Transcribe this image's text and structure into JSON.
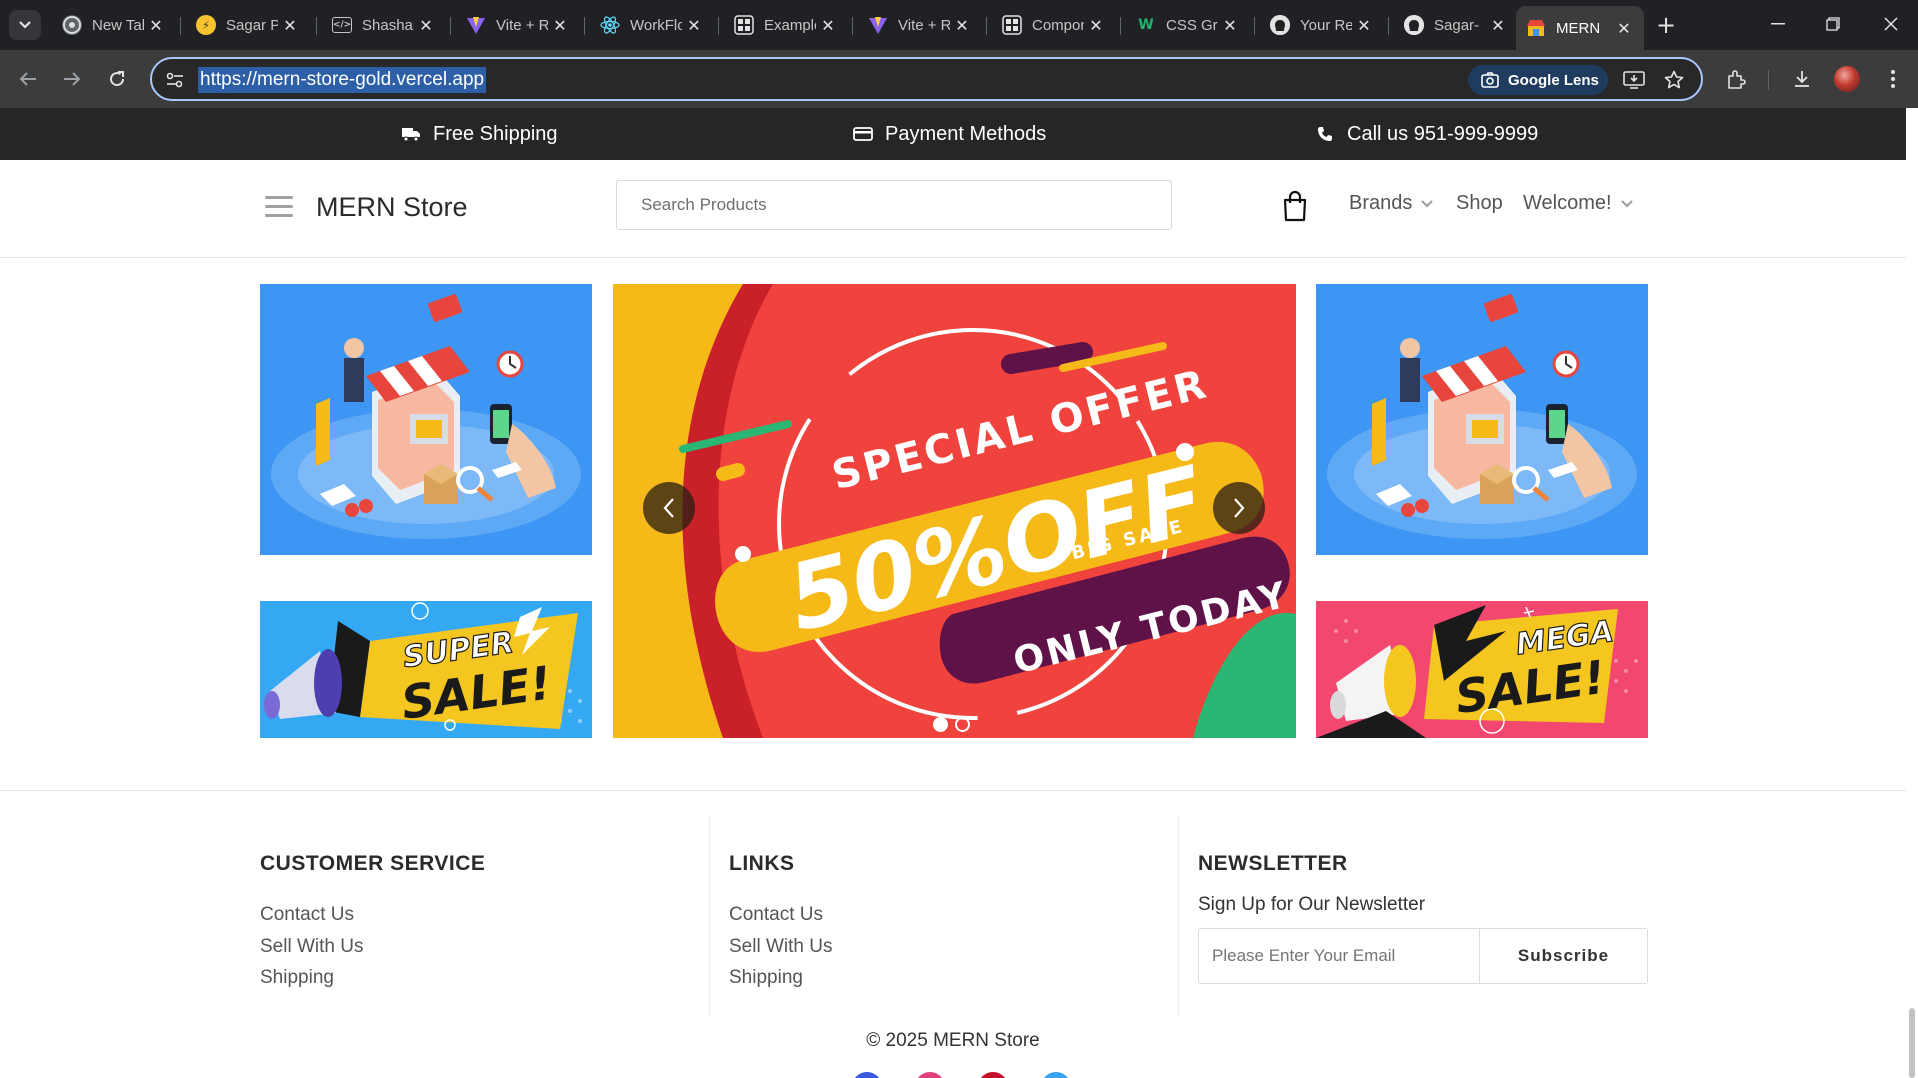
{
  "browser": {
    "tabs": [
      {
        "label": "New Tab",
        "icon": "chrome-icon"
      },
      {
        "label": "Sagar Portfolio",
        "icon": "lightning-icon"
      },
      {
        "label": "Shashank",
        "icon": "code-icon"
      },
      {
        "label": "Vite + React",
        "icon": "vite-icon"
      },
      {
        "label": "WorkFlow",
        "icon": "react-icon"
      },
      {
        "label": "Examples",
        "icon": "grid-icon"
      },
      {
        "label": "Vite + React",
        "icon": "vite-icon"
      },
      {
        "label": "Components",
        "icon": "grid-icon"
      },
      {
        "label": "CSS Grid",
        "icon": "w-icon"
      },
      {
        "label": "Your Repositories",
        "icon": "github-icon"
      },
      {
        "label": "Sagar-",
        "icon": "github-icon"
      },
      {
        "label": "MERN",
        "icon": "store-icon"
      }
    ],
    "active_tab_index": 11,
    "url": "https://mern-store-gold.vercel.app",
    "lens_label": "Google Lens"
  },
  "topbar": {
    "shipping": "Free Shipping",
    "payment": "Payment Methods",
    "phone": "Call us 951-999-9999"
  },
  "header": {
    "brand": "MERN Store",
    "search_placeholder": "Search Products",
    "nav": {
      "brands": "Brands",
      "shop": "Shop",
      "welcome": "Welcome!"
    }
  },
  "banners": {
    "center": {
      "line1": "SPECIAL OFFER",
      "line2": "50%OFF",
      "line3": "BIG SALE",
      "line4": "ONLY TODAY"
    },
    "bottom_left": {
      "line1": "SUPER",
      "line2": "SALE!"
    },
    "bottom_right": {
      "line1": "MEGA",
      "line2": "SALE!"
    },
    "carousel_slide": 1,
    "carousel_total": 2
  },
  "footer": {
    "customer_service": {
      "title": "CUSTOMER SERVICE",
      "links": [
        "Contact Us",
        "Sell With Us",
        "Shipping"
      ]
    },
    "links": {
      "title": "LINKS",
      "links": [
        "Contact Us",
        "Sell With Us",
        "Shipping"
      ]
    },
    "newsletter": {
      "title": "NEWSLETTER",
      "subtitle": "Sign Up for Our Newsletter",
      "placeholder": "Please Enter Your Email",
      "button": "Subscribe"
    },
    "copyright": "© 2025 MERN Store"
  },
  "colors": {
    "topbar_bg": "#262626",
    "banner_blue": "#3d96f3",
    "banner_red": "#f0433d",
    "banner_yellow": "#f5b918",
    "banner_purple": "#5e1247",
    "banner_pink": "#f2476f"
  }
}
